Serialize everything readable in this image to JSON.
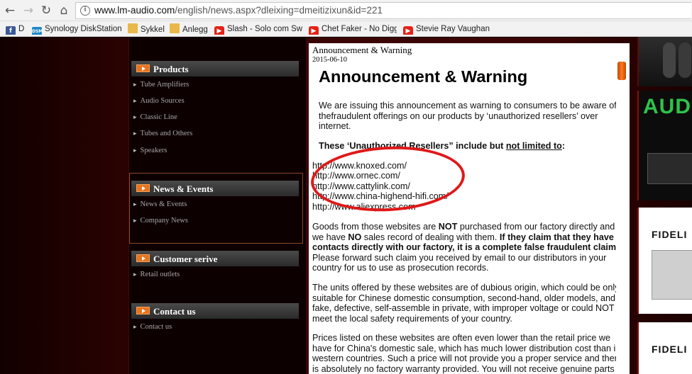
{
  "browser": {
    "url_prefix": "www.lm-audio.com",
    "url_path": "/english/news.aspx?dleixing=dmeitizixun&id=221",
    "bookmarks": [
      {
        "label": "D",
        "icon": "facebook-icon"
      },
      {
        "label": "Synology DiskStation",
        "icon": "dsm-icon"
      },
      {
        "label": "Sykkel",
        "icon": "folder-icon"
      },
      {
        "label": "Anlegg",
        "icon": "folder-icon"
      },
      {
        "label": "Slash - Solo com Swe",
        "icon": "youtube-icon"
      },
      {
        "label": "Chet Faker - No Diggi",
        "icon": "youtube-icon"
      },
      {
        "label": "Stevie Ray Vaughan -",
        "icon": "youtube-icon"
      }
    ]
  },
  "sidebar": {
    "products": {
      "title": "Products",
      "items": [
        "Tube Amplifiers",
        "Audio Sources",
        "Classic Line",
        "Tubes and Others",
        "Speakers"
      ]
    },
    "news": {
      "title": "News & Events",
      "items": [
        "News & Events",
        "Company News"
      ]
    },
    "customer": {
      "title": "Customer serive",
      "items": [
        "Retail outlets"
      ]
    },
    "contact": {
      "title": "Contact us",
      "items": [
        "Contact us"
      ]
    }
  },
  "article": {
    "breadcrumb": "Announcement & Warning",
    "date": "2015-06-10",
    "headline": "Announcement & Warning",
    "p1": "We are issuing this announcement as warning to consumers to be aware of thefraudulent offerings on our products by ‘unauthorized resellers’ over internet.",
    "p2_prefix": "These ‘Unauthorized Resellers” include but ",
    "p2_underline": "not limited to",
    "p2_suffix": ":",
    "links": [
      "http://www.knoxed.com/",
      "http://www.ornec.com/",
      "http://www.cattylink.com/",
      "http://www.china-highend-hifi.com/",
      "http://www.aliexpress.com"
    ],
    "p3": {
      "a": "Goods from those websites are ",
      "b": "NOT",
      "c": " purchased from our factory directly and we have ",
      "d": "NO",
      "e": " sales record of dealing with them.  ",
      "f": "If they claim that they have contacts directly with our factory, it is a complete false fraudulent claim.",
      "g": " Please forward such claim you received by email to our distributors in your country for us to use as prosecution records."
    },
    "p4": "The units offered by these websites are of dubious origin, which could be only suitable for Chinese domestic consumption, second-hand, older models, and fake, defective, self-assemble in private, with improper voltage or could NOT meet the local safety requirements of your country.",
    "p5": "Prices listed on these websites are often even lower than the retail price we have for China's domestic sale, which has much lower distribution cost than in western countries. Such a price will not provide you a proper service and there is absolutely no factory warranty provided. You will not receive genuine parts or qualified services for your purchase. We as manufacturer"
  },
  "banners": {
    "ad2_text": "AUDI",
    "ad3_text": "FIDELI",
    "ad4_text": "FIDELI"
  },
  "colors": {
    "accent": "#e8731e",
    "annotation": "#e01818"
  }
}
